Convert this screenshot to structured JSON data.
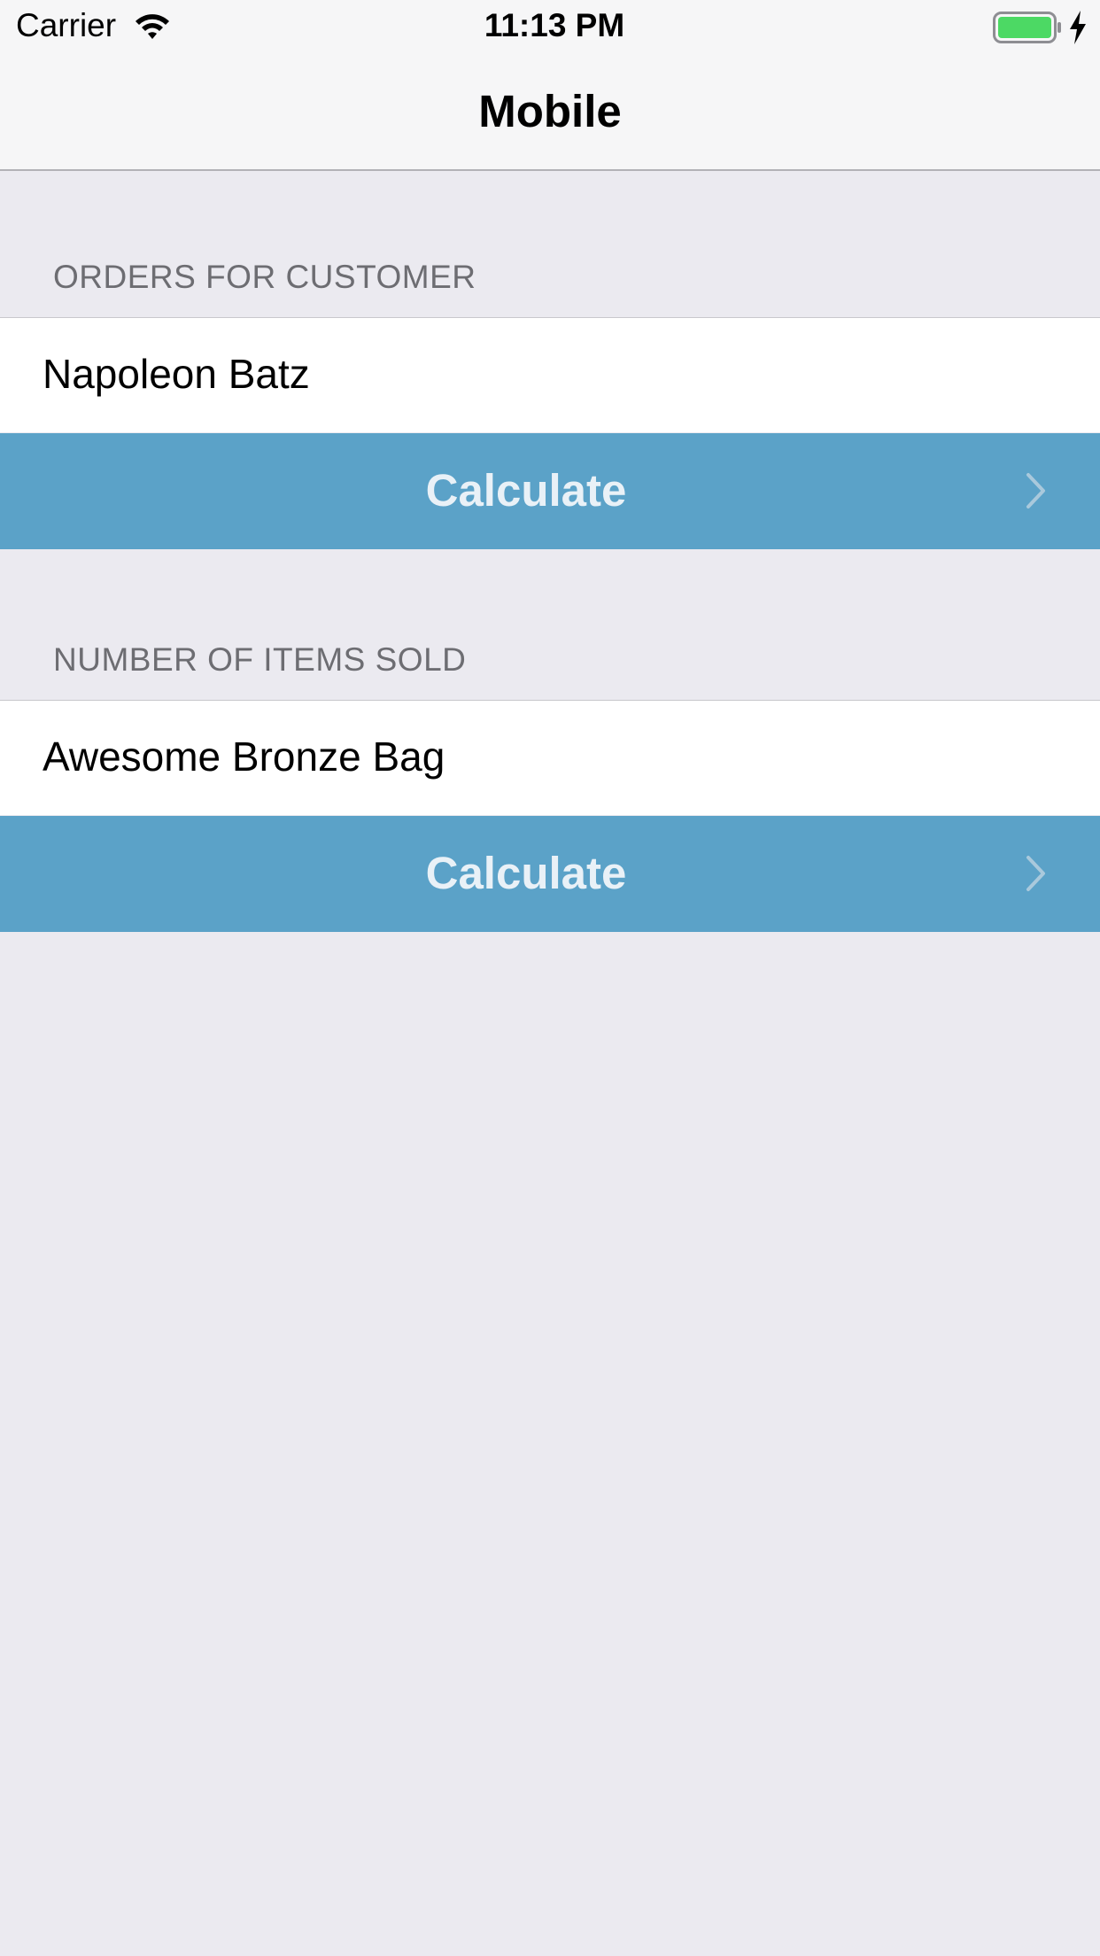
{
  "status_bar": {
    "carrier": "Carrier",
    "time": "11:13 PM",
    "wifi_icon": "wifi-icon",
    "battery_icon": "battery-full-icon",
    "charging_icon": "charging-bolt-icon",
    "battery_color": "#4cd964"
  },
  "nav": {
    "title": "Mobile"
  },
  "sections": [
    {
      "header": "ORDERS FOR CUSTOMER",
      "value": "Napoleon Batz",
      "button_label": "Calculate"
    },
    {
      "header": "NUMBER OF ITEMS SOLD",
      "value": "Awesome Bronze Bag",
      "button_label": "Calculate"
    }
  ],
  "colors": {
    "background": "#ebeaf0",
    "button": "#5ba2c8",
    "button_text": "#e9f1f7",
    "section_header": "#6d6d72"
  }
}
